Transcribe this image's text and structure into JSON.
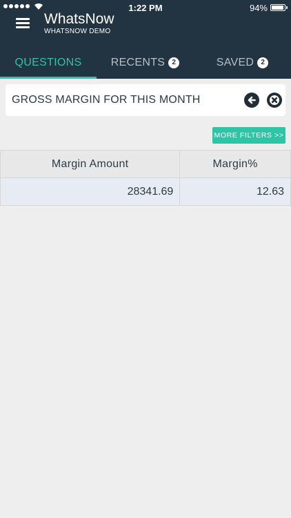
{
  "status_bar": {
    "time": "1:22 PM",
    "battery": "94%"
  },
  "header": {
    "title": "WhatsNow",
    "subtitle": "WHATSNOW DEMO"
  },
  "tabs": [
    {
      "label": "QUESTIONS",
      "badge": null,
      "active": true
    },
    {
      "label": "RECENTS",
      "badge": "2",
      "active": false
    },
    {
      "label": "SAVED",
      "badge": "2",
      "active": false
    }
  ],
  "query": {
    "text": "GROSS MARGIN FOR THIS MONTH"
  },
  "filters_button": "MORE FILTERS >>",
  "table": {
    "columns": [
      "Margin Amount",
      "Margin%"
    ],
    "rows": [
      [
        "28341.69",
        "12.63"
      ]
    ]
  },
  "colors": {
    "header_bg": "#223341",
    "accent": "#2ec4a6",
    "page_bg": "#eeeeee"
  }
}
